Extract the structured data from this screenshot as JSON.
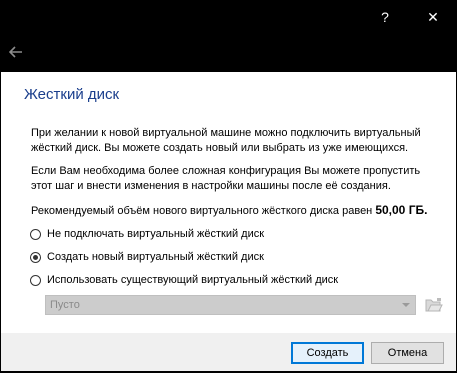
{
  "titlebar": {
    "help_label": "?",
    "close_label": "✕",
    "background": "#000000"
  },
  "nav": {
    "back_icon": "arrow-left-icon"
  },
  "page": {
    "title": "Жесткий диск",
    "title_color": "#1a3e8c",
    "paragraph1": "При желании к новой виртуальной машине можно подключить виртуальный жёсткий диск. Вы можете создать новый или выбрать из уже имеющихся.",
    "paragraph2": "Если Вам необходима более сложная конфигурация Вы можете пропустить этот шаг и внести изменения в настройки машины после её создания.",
    "recommended_label": "Рекомендуемый объём нового виртуального жёсткого диска равен",
    "recommended_size": "50,00 ГБ."
  },
  "options": {
    "selected": "create_new",
    "no_disk_label": "Не подключать виртуальный жёсткий диск",
    "create_new_label": "Создать новый виртуальный жёсткий диск",
    "use_existing_label": "Использовать существующий виртуальный жёсткий диск"
  },
  "existing_disk": {
    "value": "Пусто",
    "disabled": true
  },
  "buttons": {
    "create_label": "Создать",
    "cancel_label": "Отмена",
    "accent": "#0078d7"
  }
}
